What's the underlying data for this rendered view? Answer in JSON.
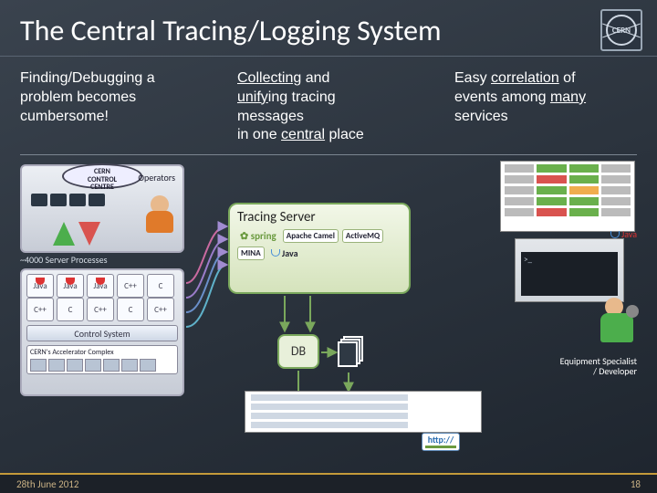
{
  "title": "The Central Tracing/Logging System",
  "logo": "cern-logo",
  "columns": {
    "c1": {
      "t1": "Finding/Debugging a",
      "t2": "problem becomes",
      "t3": "cumbersome!"
    },
    "c2": {
      "t1a": "Collecting",
      "t1b": " and",
      "t2a": "unify",
      "t2b": "ing tracing",
      "t3": "messages",
      "t4a": "in one ",
      "t4b": "central",
      "t4c": " place"
    },
    "c3": {
      "t1a": "Easy ",
      "t1b": "correlation",
      "t1c": " of",
      "t2a": "events among ",
      "t2b": "many",
      "t3": "services"
    }
  },
  "control_centre": {
    "badge_l1": "CERN",
    "badge_l2": "CONTROL",
    "badge_l3": "CENTRE",
    "operators": "Operators"
  },
  "stack": {
    "top": "~4000 Server Processes",
    "langs": [
      "Java",
      "Java",
      "Java",
      "C++",
      "C",
      "C++",
      "C",
      "C++",
      "C",
      "C++"
    ],
    "control": "Control System",
    "accel": "CERN's Accelerator Complex"
  },
  "proc_label": "~4000 Server Processes",
  "tracing_server": {
    "title": "Tracing Server",
    "chips": [
      "spring",
      "Apache Camel",
      "ActiveMQ",
      "MINA",
      "Java"
    ]
  },
  "db": "DB",
  "dev_label": {
    "l1": "Equipment Specialist",
    "l2": "/ Developer"
  },
  "http": "http://",
  "java_label": "Java",
  "footer": {
    "date": "28th June 2012",
    "page": "18"
  }
}
